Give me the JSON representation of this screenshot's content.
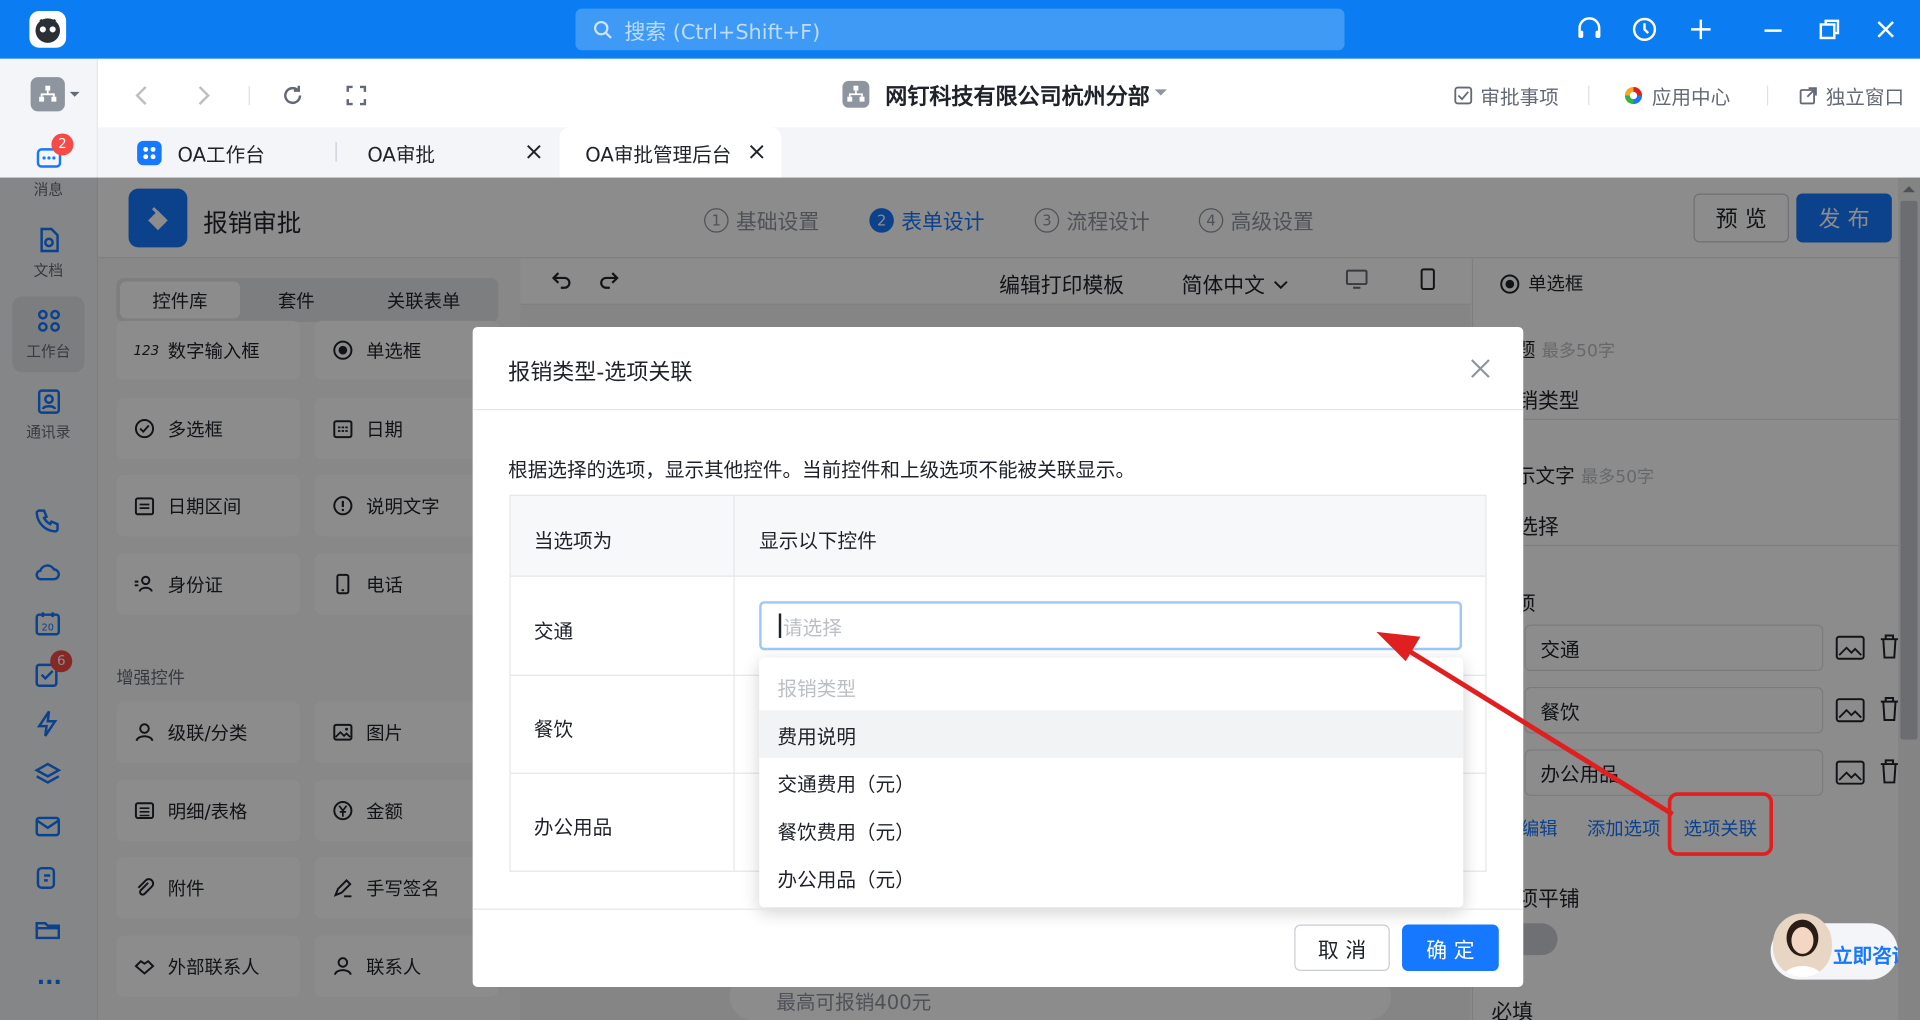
{
  "topbar": {
    "search_placeholder": "搜索 (Ctrl+Shift+F)"
  },
  "rail": {
    "items": [
      {
        "label": "消息",
        "badge": "2"
      },
      {
        "label": "文档"
      },
      {
        "label": "工作台"
      },
      {
        "label": "通讯录"
      }
    ],
    "todo_badge": "6",
    "more": "···"
  },
  "header": {
    "org_name": "网钉科技有限公司杭州分部",
    "links": [
      "审批事项",
      "应用中心",
      "独立窗口"
    ]
  },
  "tabs": [
    {
      "label": "OA工作台"
    },
    {
      "label": "OA审批"
    },
    {
      "label": "OA审批管理后台"
    }
  ],
  "app": {
    "title": "报销审批",
    "steps": [
      {
        "num": "1",
        "label": "基础设置"
      },
      {
        "num": "2",
        "label": "表单设计"
      },
      {
        "num": "3",
        "label": "流程设计"
      },
      {
        "num": "4",
        "label": "高级设置"
      }
    ],
    "preview": "预 览",
    "publish": "发 布"
  },
  "library": {
    "segments": [
      "控件库",
      "套件",
      "关联表单"
    ],
    "controls": [
      "数字输入框",
      "单选框",
      "多选框",
      "日期",
      "日期区间",
      "说明文字",
      "身份证",
      "电话"
    ],
    "section_title": "增强控件",
    "enhanced": [
      "级联/分类",
      "图片",
      "明细/表格",
      "金额",
      "附件",
      "手写签名",
      "外部联系人",
      "联系人"
    ],
    "num_icon": "123"
  },
  "canvas": {
    "edit_print": "编辑打印模板",
    "language": "简体中文",
    "bottom_text": "最高可报销400元"
  },
  "props": {
    "control_type": "单选框",
    "title_label": "标题",
    "title_hint": "最多50字",
    "title_value": "报销类型",
    "placeholder_label": "提示文字",
    "placeholder_hint": "最多50字",
    "placeholder_value": "请选择",
    "options_label": "选项",
    "options": [
      "交通",
      "餐饮",
      "办公用品"
    ],
    "batch_edit": "批量编辑",
    "add_option": "添加选项",
    "option_link": "选项关联",
    "tile_label": "选项平铺",
    "required_label": "必填",
    "consult": "立即咨询"
  },
  "modal": {
    "title": "报销类型-选项关联",
    "description": "根据选择的选项，显示其他控件。当前控件和上级选项不能被关联显示。",
    "col1": "当选项为",
    "col2": "显示以下控件",
    "rows": [
      "交通",
      "餐饮",
      "办公用品"
    ],
    "select_placeholder": "请选择",
    "dropdown_group": "报销类型",
    "dropdown_items": [
      "费用说明",
      "交通费用（元）",
      "餐饮费用（元）",
      "办公用品（元）"
    ],
    "cancel": "取 消",
    "ok": "确 定"
  },
  "colors": {
    "primary": "#0b7cf2",
    "accent_blue": "#1677ff",
    "highlight_red": "#e02020"
  }
}
